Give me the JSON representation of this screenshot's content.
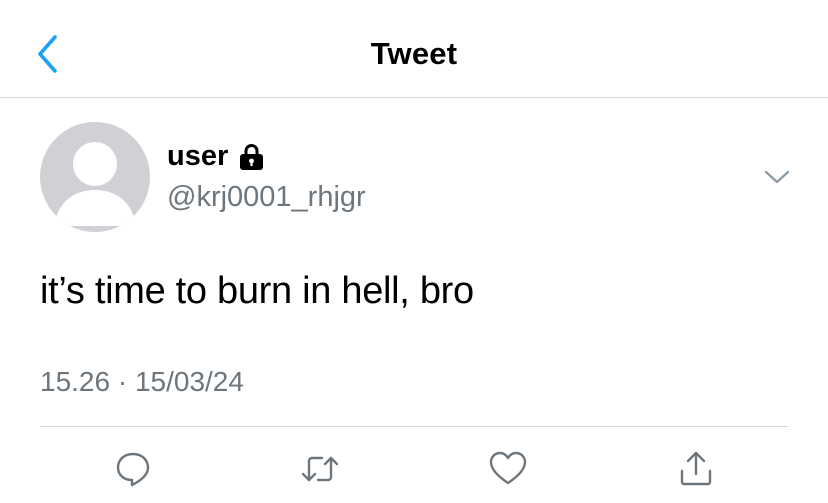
{
  "header": {
    "title": "Tweet",
    "back_icon": "chevron-left-icon",
    "accent_color": "#1da1f2"
  },
  "tweet": {
    "author": {
      "display_name": "user",
      "handle": "@krj0001_rhjgr",
      "protected_icon": "lock-icon",
      "avatar": "default-avatar-icon"
    },
    "text": "it’s time to burn in hell, bro",
    "timestamp": "15.26 · 15/03/24",
    "more_icon": "chevron-down-icon"
  },
  "actions": [
    {
      "name": "reply",
      "icon": "comment-icon"
    },
    {
      "name": "retweet",
      "icon": "retweet-icon"
    },
    {
      "name": "like",
      "icon": "heart-icon"
    },
    {
      "name": "share",
      "icon": "share-icon"
    }
  ],
  "colors": {
    "secondary_text": "#6e767d",
    "divider": "#d4d4d4",
    "avatar_bg": "#cfd1d4"
  }
}
